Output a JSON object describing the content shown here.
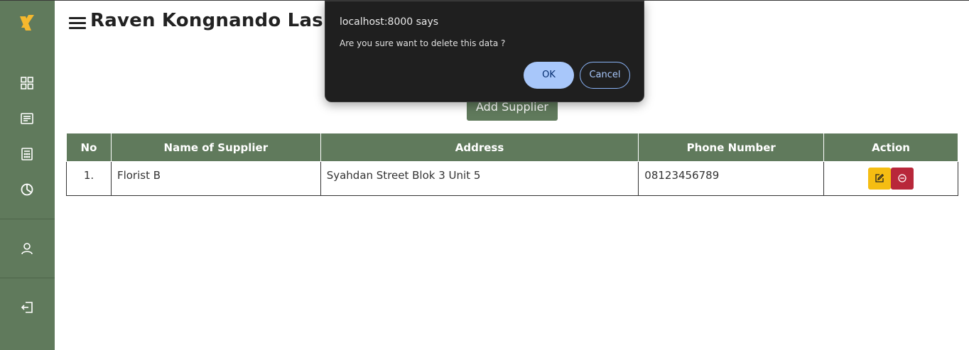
{
  "header": {
    "title": "Raven Kongnando Lasher"
  },
  "sidebar": {
    "icons": [
      "dashboard-icon",
      "list-icon",
      "calculator-icon",
      "chart-pie-icon",
      "user-icon",
      "logout-icon"
    ]
  },
  "actions": {
    "add_supplier_label": "Add Supplier"
  },
  "table": {
    "headers": [
      "No",
      "Name of Supplier",
      "Address",
      "Phone Number",
      "Action"
    ],
    "rows": [
      {
        "no": "1.",
        "name": "Florist B",
        "address": "Syahdan Street Blok 3 Unit 5",
        "phone": "08123456789"
      }
    ]
  },
  "dialog": {
    "title": "localhost:8000 says",
    "message": "Are you sure want to delete this data ?",
    "ok_label": "OK",
    "cancel_label": "Cancel"
  },
  "colors": {
    "sidebar": "#607a5c",
    "accent_logo": "#f5b82e",
    "edit_button": "#f5bd12",
    "delete_button": "#b8273a",
    "dialog_bg": "#1f1f1f",
    "ok_button": "#a8c7fa"
  }
}
